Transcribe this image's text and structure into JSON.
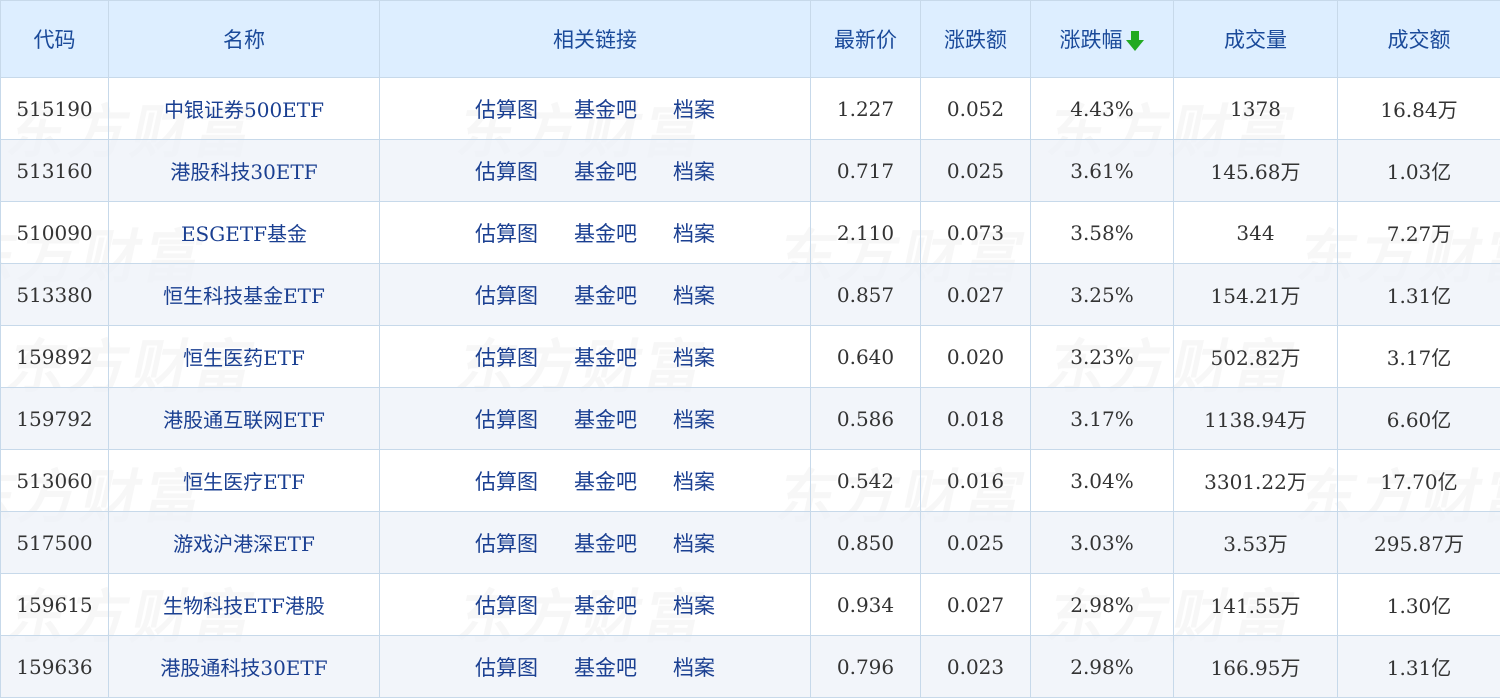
{
  "watermark": {
    "text": "东方财富"
  },
  "colors": {
    "header_bg": "#ddeeff",
    "link": "#1a3f91",
    "up": "#e8112d",
    "sort_arrow": "#22aa22"
  },
  "header": {
    "code": "代码",
    "name": "名称",
    "links": "相关链接",
    "price": "最新价",
    "change": "涨跌额",
    "change_pct": "涨跌幅",
    "sort_icon": "sort-desc-arrow-icon",
    "volume": "成交量",
    "amount": "成交额"
  },
  "link_labels": {
    "chart": "估算图",
    "forum": "基金吧",
    "profile": "档案"
  },
  "rows": [
    {
      "code": "515190",
      "name": "中银证券500ETF",
      "price": "1.227",
      "change": "0.052",
      "change_pct": "4.43%",
      "volume": "1378",
      "amount": "16.84万"
    },
    {
      "code": "513160",
      "name": "港股科技30ETF",
      "price": "0.717",
      "change": "0.025",
      "change_pct": "3.61%",
      "volume": "145.68万",
      "amount": "1.03亿"
    },
    {
      "code": "510090",
      "name": "ESGETF基金",
      "price": "2.110",
      "change": "0.073",
      "change_pct": "3.58%",
      "volume": "344",
      "amount": "7.27万"
    },
    {
      "code": "513380",
      "name": "恒生科技基金ETF",
      "price": "0.857",
      "change": "0.027",
      "change_pct": "3.25%",
      "volume": "154.21万",
      "amount": "1.31亿"
    },
    {
      "code": "159892",
      "name": "恒生医药ETF",
      "price": "0.640",
      "change": "0.020",
      "change_pct": "3.23%",
      "volume": "502.82万",
      "amount": "3.17亿"
    },
    {
      "code": "159792",
      "name": "港股通互联网ETF",
      "price": "0.586",
      "change": "0.018",
      "change_pct": "3.17%",
      "volume": "1138.94万",
      "amount": "6.60亿"
    },
    {
      "code": "513060",
      "name": "恒生医疗ETF",
      "price": "0.542",
      "change": "0.016",
      "change_pct": "3.04%",
      "volume": "3301.22万",
      "amount": "17.70亿"
    },
    {
      "code": "517500",
      "name": "游戏沪港深ETF",
      "price": "0.850",
      "change": "0.025",
      "change_pct": "3.03%",
      "volume": "3.53万",
      "amount": "295.87万"
    },
    {
      "code": "159615",
      "name": "生物科技ETF港股",
      "price": "0.934",
      "change": "0.027",
      "change_pct": "2.98%",
      "volume": "141.55万",
      "amount": "1.30亿"
    },
    {
      "code": "159636",
      "name": "港股通科技30ETF",
      "price": "0.796",
      "change": "0.023",
      "change_pct": "2.98%",
      "volume": "166.95万",
      "amount": "1.31亿"
    }
  ]
}
